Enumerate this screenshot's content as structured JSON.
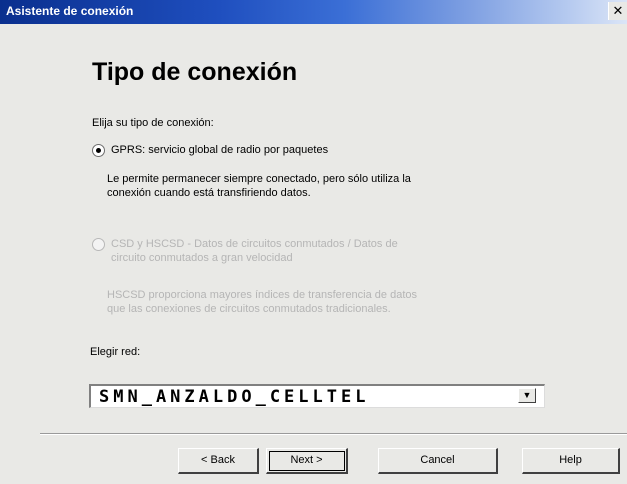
{
  "window": {
    "title": "Asistente de conexión",
    "close_glyph": "✕"
  },
  "header": {
    "title": "Tipo de conexión"
  },
  "prompt": "Elija su tipo de conexión:",
  "options": [
    {
      "label": "GPRS: servicio global de radio por paquetes",
      "description_lines": [
        "Le permite permanecer siempre conectado, pero sólo utiliza la",
        "conexión cuando está transfiriendo datos."
      ],
      "selected": true,
      "enabled": true
    },
    {
      "label_lines": [
        "CSD y HSCSD - Datos de circuitos conmutados / Datos de",
        "circuito conmutados a gran velocidad"
      ],
      "description_lines": [
        "HSCSD proporciona mayores índices de transferencia de datos",
        "que las conexiones de circuitos conmutados tradicionales."
      ],
      "selected": false,
      "enabled": false
    }
  ],
  "network": {
    "label": "Elegir red:",
    "value": "SMN_ANZALDO_CELLTEL",
    "arrow": "▼"
  },
  "buttons": {
    "back": "< Back",
    "next": "Next >",
    "cancel": "Cancel",
    "help": "Help"
  }
}
